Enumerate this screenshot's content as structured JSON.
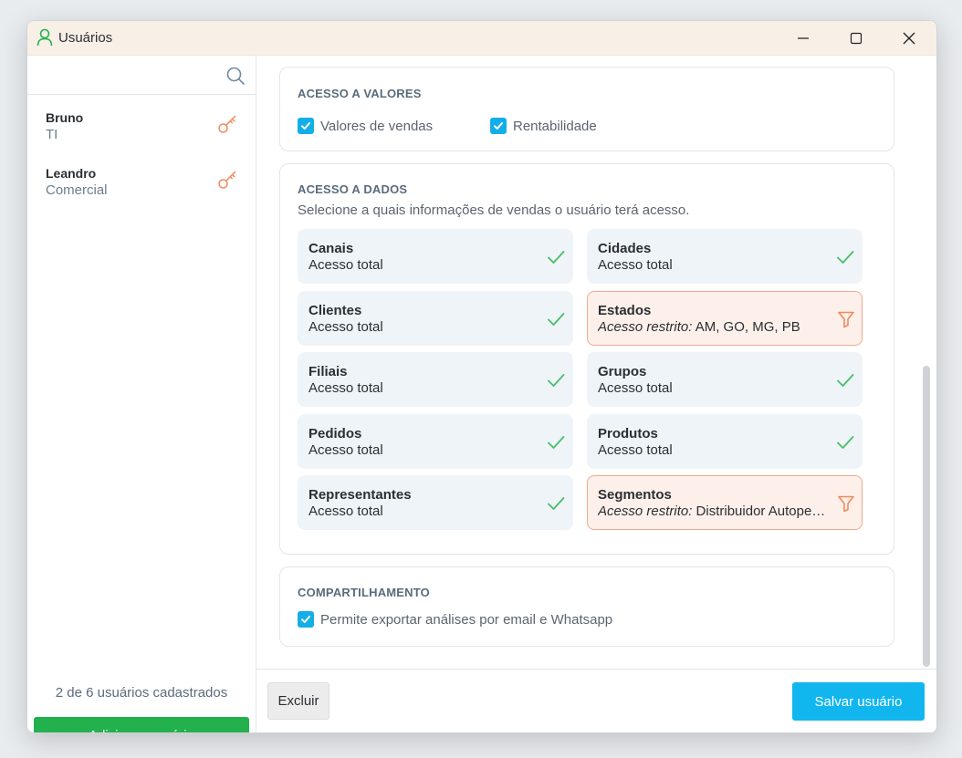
{
  "window": {
    "title": "Usuários",
    "accent_color": "#22b14c"
  },
  "sidebar": {
    "search": {
      "value": "",
      "placeholder": "",
      "icon": "search-icon"
    },
    "users": [
      {
        "name": "Bruno",
        "role": "TI",
        "icon": "key-icon"
      },
      {
        "name": "Leandro",
        "role": "Comercial",
        "icon": "key-icon"
      }
    ],
    "count_text": "2 de 6 usuários cadastrados",
    "add_label": "Adicionar usuário"
  },
  "sections": {
    "valores": {
      "title": "ACESSO A VALORES",
      "options": [
        {
          "label": "Valores de vendas",
          "checked": true
        },
        {
          "label": "Rentabilidade",
          "checked": true
        }
      ]
    },
    "dados": {
      "title": "ACESSO A DADOS",
      "subtitle": "Selecione a quais informações de vendas o usuário terá acesso.",
      "restricted_prefix": "Acesso restrito:",
      "tiles": [
        {
          "name": "Canais",
          "status": "Acesso total",
          "restricted": false,
          "icon": "check-icon"
        },
        {
          "name": "Cidades",
          "status": "Acesso total",
          "restricted": false,
          "icon": "check-icon"
        },
        {
          "name": "Clientes",
          "status": "Acesso total",
          "restricted": false,
          "icon": "check-icon"
        },
        {
          "name": "Estados",
          "status": "AM, GO, MG, PB",
          "restricted": true,
          "icon": "filter-icon"
        },
        {
          "name": "Filiais",
          "status": "Acesso total",
          "restricted": false,
          "icon": "check-icon"
        },
        {
          "name": "Grupos",
          "status": "Acesso total",
          "restricted": false,
          "icon": "check-icon"
        },
        {
          "name": "Pedidos",
          "status": "Acesso total",
          "restricted": false,
          "icon": "check-icon"
        },
        {
          "name": "Produtos",
          "status": "Acesso total",
          "restricted": false,
          "icon": "check-icon"
        },
        {
          "name": "Representantes",
          "status": "Acesso total",
          "restricted": false,
          "icon": "check-icon"
        },
        {
          "name": "Segmentos",
          "status": "Distribuidor Autopeças",
          "restricted": true,
          "icon": "filter-icon"
        }
      ]
    },
    "compartilhamento": {
      "title": "COMPARTILHAMENTO",
      "options": [
        {
          "label": "Permite exportar análises por email e Whatsapp",
          "checked": true
        }
      ]
    }
  },
  "footer": {
    "delete_label": "Excluir",
    "save_label": "Salvar usuário"
  },
  "colors": {
    "checkbox": "#13aee7",
    "check_icon": "#4cbf6b",
    "restricted_border": "#f0a98d",
    "restricted_bg": "#fdf0ea",
    "filter_icon": "#ef8a5f",
    "key_icon": "#ef8a5f",
    "save_button": "#12b6ef",
    "add_button": "#22b14c"
  }
}
